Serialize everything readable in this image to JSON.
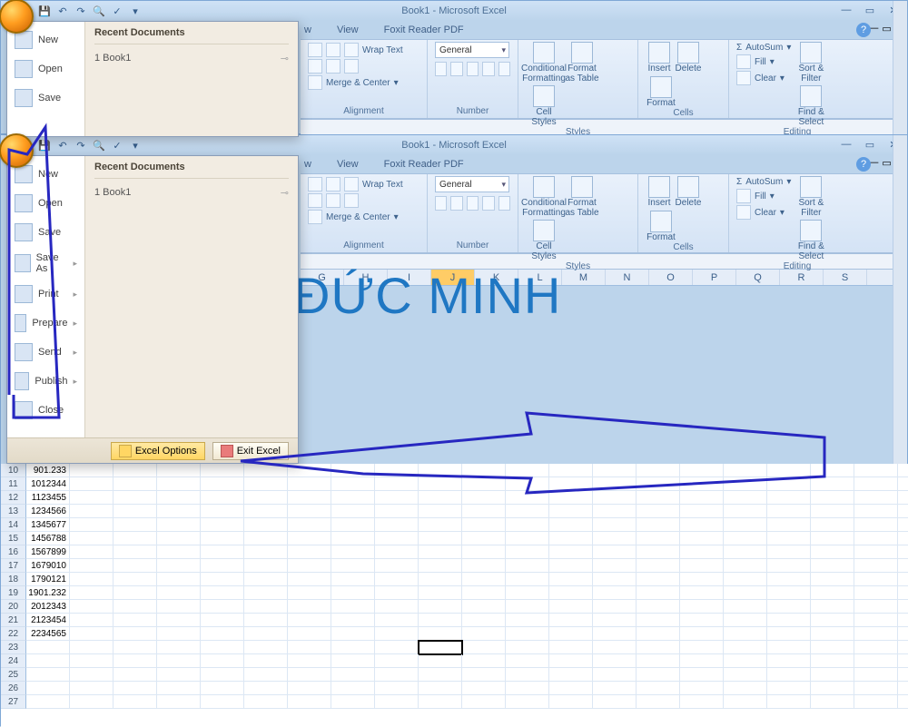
{
  "app_title": "Book1 - Microsoft Excel",
  "qat_icons": [
    "save-icon",
    "undo-icon",
    "redo-icon",
    "print-preview-icon",
    "spelling-icon",
    "more-icon"
  ],
  "ribbon_tabs_visible": [
    "w",
    "View",
    "Foxit Reader PDF"
  ],
  "alignment": {
    "wrap": "Wrap Text",
    "merge": "Merge & Center",
    "label": "Alignment"
  },
  "number": {
    "format": "General",
    "label": "Number"
  },
  "styles": {
    "cond": "Conditional Formatting",
    "tbl": "Format as Table",
    "cell": "Cell Styles",
    "label": "Styles"
  },
  "cellsg": {
    "ins": "Insert",
    "del": "Delete",
    "fmt": "Format",
    "label": "Cells"
  },
  "editing": {
    "sum": "AutoSum",
    "fill": "Fill",
    "clear": "Clear",
    "sort": "Sort & Filter",
    "find": "Find & Select",
    "label": "Editing"
  },
  "cols_top": [
    "G",
    "H",
    "I",
    "J",
    "K",
    "L",
    "M",
    "N",
    "O",
    "P",
    "Q",
    "R",
    "S"
  ],
  "office_menu": {
    "items": [
      {
        "label": "New",
        "arrow": false
      },
      {
        "label": "Open",
        "arrow": false
      },
      {
        "label": "Save",
        "arrow": false
      },
      {
        "label": "Save As",
        "arrow": true
      },
      {
        "label": "Print",
        "arrow": true
      },
      {
        "label": "Prepare",
        "arrow": true
      },
      {
        "label": "Send",
        "arrow": true
      },
      {
        "label": "Publish",
        "arrow": true
      },
      {
        "label": "Close",
        "arrow": false
      }
    ],
    "recent_hd": "Recent Documents",
    "recent_items": [
      "1  Book1"
    ],
    "options_btn": "Excel Options",
    "exit_btn": "Exit Excel"
  },
  "big_text": "ĐỨC MINH",
  "data_col_values": [
    "901.233",
    "1012344",
    "1123455",
    "1234566",
    "1345677",
    "1456788",
    "1567899",
    "1679010",
    "1790121",
    "1901.232",
    "2012343",
    "2123454",
    "2234565"
  ],
  "data_row_start": 10,
  "selected_cell_row": 23,
  "total_rows_shown": 27,
  "col_widths": {
    "data": 48,
    "wide": 48
  }
}
